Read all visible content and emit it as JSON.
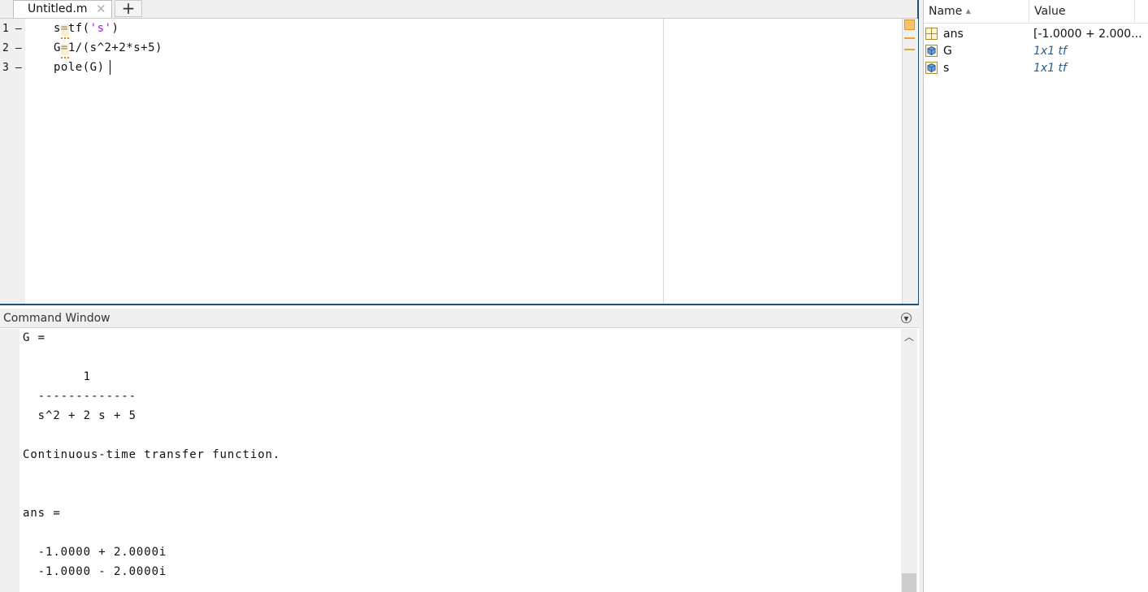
{
  "editor": {
    "tab_label": "Untitled.m",
    "tab_close_glyph": "✕",
    "add_tab_glyph": "+",
    "lines": [
      {
        "number": "1",
        "marker": "–",
        "code_pre": "s=tf(",
        "code_str": "'s'",
        "code_post": ")"
      },
      {
        "number": "2",
        "marker": "–",
        "code": "G=1/(s^2+2*s+5)"
      },
      {
        "number": "3",
        "marker": "–",
        "code": "pole(G)"
      }
    ],
    "analyzer_status_color": "#f7c26b"
  },
  "command_window": {
    "title": "Command Window",
    "output": [
      "G =",
      "",
      "        1",
      "  -------------",
      "  s^2 + 2 s + 5",
      "",
      "Continuous-time transfer function.",
      "",
      "",
      "ans =",
      "",
      "  -1.0000 + 2.0000i",
      "  -1.0000 - 2.0000i"
    ]
  },
  "workspace": {
    "columns": {
      "name": "Name",
      "sort_glyph": "▲",
      "value": "Value"
    },
    "variables": [
      {
        "name": "ans",
        "value": "[-1.0000 + 2.000...",
        "icon": "matrix-icon"
      },
      {
        "name": "G",
        "value": "1x1 tf",
        "icon": "object-icon"
      },
      {
        "name": "s",
        "value": "1x1 tf",
        "icon": "object-icon"
      }
    ]
  }
}
